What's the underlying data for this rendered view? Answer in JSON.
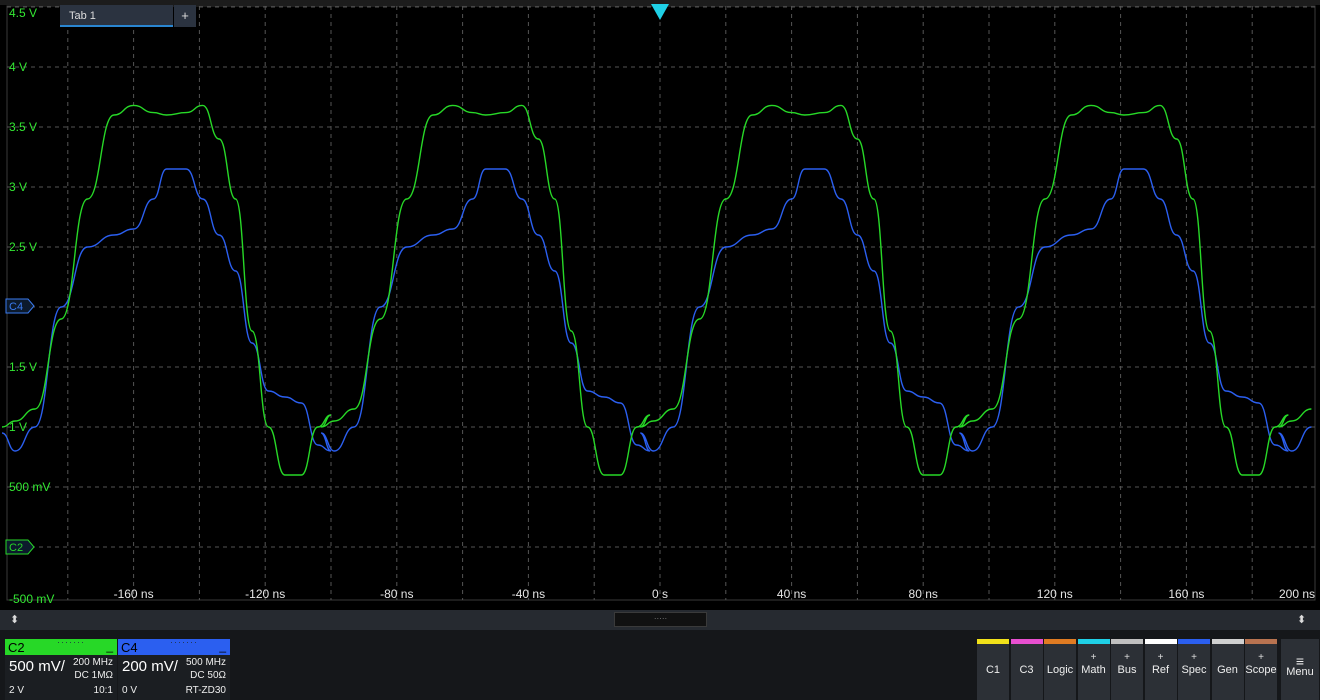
{
  "tab": {
    "label": "Tab 1",
    "add_label": "+"
  },
  "colors": {
    "c2": "#27d827",
    "c4": "#2b5ff0",
    "grid": "#555555",
    "trigger": "#1fd0e6",
    "axis_text": "#33e833",
    "x_text": "#e6e6e6"
  },
  "y_axis": {
    "labels": [
      "4.5 V",
      "4 V",
      "3.5 V",
      "3 V",
      "2.5 V",
      "",
      "1.5 V",
      "1 V",
      "500 mV",
      "",
      "-500 mV"
    ],
    "values": [
      4.5,
      4,
      3.5,
      3,
      2.5,
      2,
      1.5,
      1,
      0.5,
      0,
      -0.5
    ]
  },
  "x_axis": {
    "labels": [
      "-160 ns",
      "-120 ns",
      "-80 ns",
      "-40 ns",
      "0 s",
      "40 ns",
      "80 ns",
      "120 ns",
      "160 ns",
      "200 ns"
    ],
    "values": [
      -160,
      -120,
      -80,
      -40,
      0,
      40,
      80,
      120,
      160,
      200
    ],
    "range_ns": [
      -200,
      200
    ]
  },
  "markers": {
    "c4": "C4",
    "c2": "C2"
  },
  "chart_data": {
    "type": "line",
    "xlabel": "",
    "ylabel": "",
    "x_unit": "ns",
    "y_unit": "V",
    "xlim": [
      -200,
      200
    ],
    "ylim": [
      -0.5,
      4.5
    ],
    "grid": true,
    "period_ns": 97,
    "series": [
      {
        "name": "C2",
        "x": [
          -200,
          -196,
          -190,
          -182,
          -174,
          -166,
          -160,
          -154,
          -150,
          -144,
          -139,
          -134,
          -129,
          -124,
          -119,
          -114,
          -109,
          -104,
          -100,
          -97
        ],
        "y": [
          1.0,
          1.05,
          1.15,
          1.9,
          2.9,
          3.6,
          3.68,
          3.62,
          3.6,
          3.62,
          3.68,
          3.4,
          2.9,
          1.8,
          1.0,
          0.6,
          0.6,
          1.0,
          1.1,
          1.0
        ]
      },
      {
        "name": "C4",
        "x": [
          -200,
          -196,
          -190,
          -182,
          -174,
          -166,
          -160,
          -154,
          -150,
          -144,
          -139,
          -134,
          -129,
          -124,
          -119,
          -114,
          -109,
          -104,
          -100,
          -97
        ],
        "y": [
          0.95,
          0.8,
          1.0,
          2.0,
          2.5,
          2.6,
          2.65,
          2.9,
          3.15,
          3.15,
          2.9,
          2.6,
          2.3,
          1.7,
          1.3,
          1.25,
          1.2,
          0.85,
          0.8,
          0.95
        ]
      }
    ]
  },
  "channels": [
    {
      "name": "C2",
      "min": "_",
      "dots": "·······",
      "scale": "500 mV/",
      "bw": "200 MHz",
      "coupling": "DC 1MΩ",
      "offset": "2 V",
      "ratio": "10:1",
      "color": "#27d827"
    },
    {
      "name": "C4",
      "min": "_",
      "dots": "·······",
      "scale": "200 mV/",
      "bw": "500 MHz",
      "coupling": "DC 50Ω",
      "offset": "0 V",
      "ratio": "RT-ZD30",
      "color": "#2b5ff0"
    }
  ],
  "side_buttons": [
    {
      "label": "C1",
      "plus": "",
      "color": "#f2e21a"
    },
    {
      "label": "C3",
      "plus": "",
      "color": "#e84fd0"
    },
    {
      "label": "Logic",
      "plus": "",
      "color": "#e07b22"
    },
    {
      "label": "Math",
      "plus": "+",
      "color": "#1fd0e6"
    },
    {
      "label": "Bus",
      "plus": "+",
      "color": "#c0c0c0"
    },
    {
      "label": "Ref",
      "plus": "+",
      "color": "#ffffff"
    },
    {
      "label": "Spec",
      "plus": "+",
      "color": "#2b5ff0"
    },
    {
      "label": "Gen",
      "plus": "",
      "color": "#d0d0d0"
    },
    {
      "label": "Scope",
      "plus": "+",
      "color": "#b87350"
    }
  ],
  "menu": {
    "label": "Menu",
    "icon": "≡"
  },
  "scroll": {
    "arrow": "⬍",
    "thumb_dots": "·····"
  }
}
